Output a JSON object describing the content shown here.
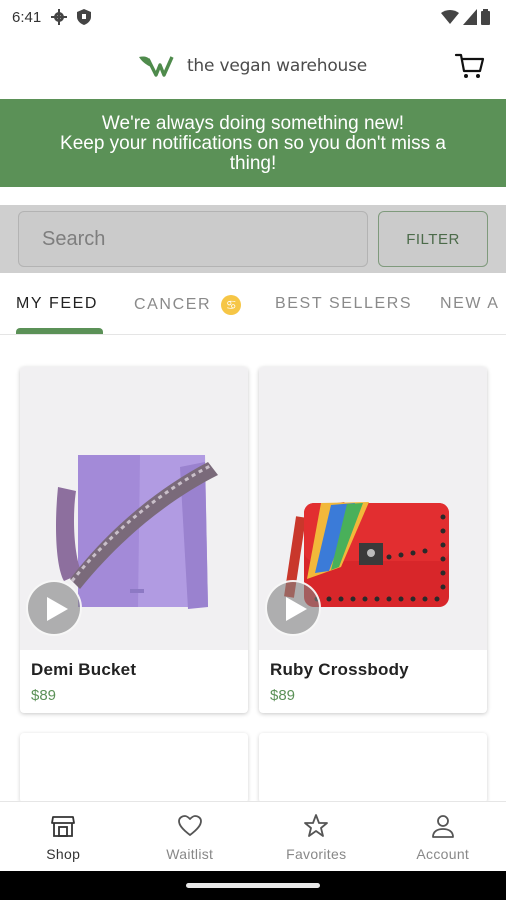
{
  "status_bar": {
    "time": "6:41"
  },
  "header": {
    "brand": "the vegan warehouse"
  },
  "banner": {
    "line1": "We're always doing something new!",
    "line2": "Keep your notifications on so you don't miss a",
    "line3": "thing!"
  },
  "search": {
    "placeholder": "Search",
    "filter_label": "FILTER"
  },
  "tabs": [
    {
      "label": "MY FEED",
      "active": true
    },
    {
      "label": "CANCER",
      "emoji": "♋"
    },
    {
      "label": "BEST SELLERS"
    },
    {
      "label": "NEW A"
    }
  ],
  "products": [
    {
      "name": "Demi Bucket",
      "price": "$89",
      "image": "purple-bucket-bag"
    },
    {
      "name": "Ruby Crossbody",
      "price": "$89",
      "image": "red-studded-crossbody"
    }
  ],
  "bottom_nav": [
    {
      "label": "Shop",
      "icon": "shop-icon",
      "active": true
    },
    {
      "label": "Waitlist",
      "icon": "heart-icon"
    },
    {
      "label": "Favorites",
      "icon": "star-icon"
    },
    {
      "label": "Account",
      "icon": "person-icon"
    }
  ],
  "colors": {
    "brand_green": "#5b9157",
    "banner_bg": "#5b9157",
    "price": "#5b9157"
  }
}
